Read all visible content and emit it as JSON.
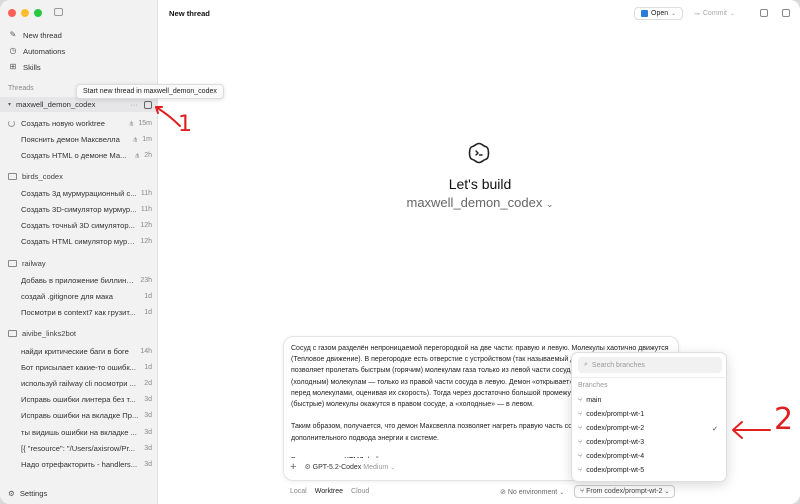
{
  "sidebar": {
    "nav": [
      {
        "label": "New thread",
        "icon": "compose-icon"
      },
      {
        "label": "Automations",
        "icon": "clock-icon"
      },
      {
        "label": "Skills",
        "icon": "grid-icon"
      }
    ],
    "threads_label": "Threads",
    "groups": [
      {
        "name": "maxwell_demon_codex",
        "threads": [
          {
            "title": "Создать новую worktree",
            "age": "15m"
          },
          {
            "title": "Пояснить демон Максвелла",
            "age": "1m"
          },
          {
            "title": "Создать HTML о демоне Ма...",
            "age": "2h"
          }
        ]
      },
      {
        "name": "birds_codex",
        "threads": [
          {
            "title": "Создать 3д мурмурационный с...",
            "age": "11h"
          },
          {
            "title": "Создать 3D-симулятор мурмур...",
            "age": "11h"
          },
          {
            "title": "Создать точный 3D симулятор...",
            "age": "12h"
          },
          {
            "title": "Создать HTML симулятор мурм...",
            "age": "12h"
          }
        ]
      },
      {
        "name": "railway",
        "threads": [
          {
            "title": "Добавь в приложение биллинг ...",
            "age": "23h"
          },
          {
            "title": "создай .gitignore для мака",
            "age": "1d"
          },
          {
            "title": "Посмотри в context7 как грузит...",
            "age": "1d"
          }
        ]
      },
      {
        "name": "aivibe_links2bot",
        "threads": [
          {
            "title": "найди критические баги в боге",
            "age": "14h"
          },
          {
            "title": "Бот присылает какие-то ошибк...",
            "age": "1d"
          },
          {
            "title": "используй railway cli посмотри ...",
            "age": "2d"
          },
          {
            "title": "Исправь ошибки линтера без т...",
            "age": "3d"
          },
          {
            "title": "Исправь ошибки на вкладке Пр...",
            "age": "3d"
          },
          {
            "title": "ты видишь ошибки на вкладке ...",
            "age": "3d"
          },
          {
            "title": "[{ \"resource\": \"/Users/axisrow/Pr...",
            "age": "3d"
          },
          {
            "title": "Надо отрефакторить - handlers...",
            "age": "3d"
          }
        ]
      }
    ],
    "settings_label": "Settings"
  },
  "tooltip": "Start new thread in maxwell_demon_codex",
  "header": {
    "title": "New thread",
    "open_label": "Open",
    "commit_label": "Commit"
  },
  "hero": {
    "heading": "Let's build",
    "project": "maxwell_demon_codex"
  },
  "composer": {
    "text": "Сосуд с газом разделён непроницаемой перегородкой на две части: правую и левую. Молекулы хаотично движутся (Тепловое движение). В перегородке есть отверстие с устройством (так называемый демон Максвелла), которое позволяет пролетать быстрым (горячим) молекулам газа только из левой части сосуда в правую, а медленным (холодным) молекулам — только из правой части сосуда в левую. Демон «открывает» и «закрывает» перегородку перед молекулами, оценивая их скорость). Тогда через достаточно большой промежуток времени «горячие» (быстрые) молекулы окажутся в правом сосуде, а «холодные» — в левом.\n\nТаким образом, получается, что демон Максвелла позволяет нагреть правую часть сосуда и охладить левую без дополнительного подвода энергии к системе.\n\nРезультат: один ХТМЛ файл.",
    "model": "GPT-5.2-Codex",
    "effort": "Medium"
  },
  "footer": {
    "tabs": [
      "Local",
      "Worktree",
      "Cloud"
    ],
    "active_tab": "Worktree",
    "environment": "No environment",
    "branch_button": "From codex/prompt-wt-2"
  },
  "branch_dropdown": {
    "search_placeholder": "Search branches",
    "label": "Branches",
    "branches": [
      "main",
      "codex/prompt-wt-1",
      "codex/prompt-wt-2",
      "codex/prompt-wt-3",
      "codex/prompt-wt-4",
      "codex/prompt-wt-5"
    ],
    "selected": "codex/prompt-wt-2"
  },
  "annotations": {
    "one": "1",
    "two": "2"
  }
}
